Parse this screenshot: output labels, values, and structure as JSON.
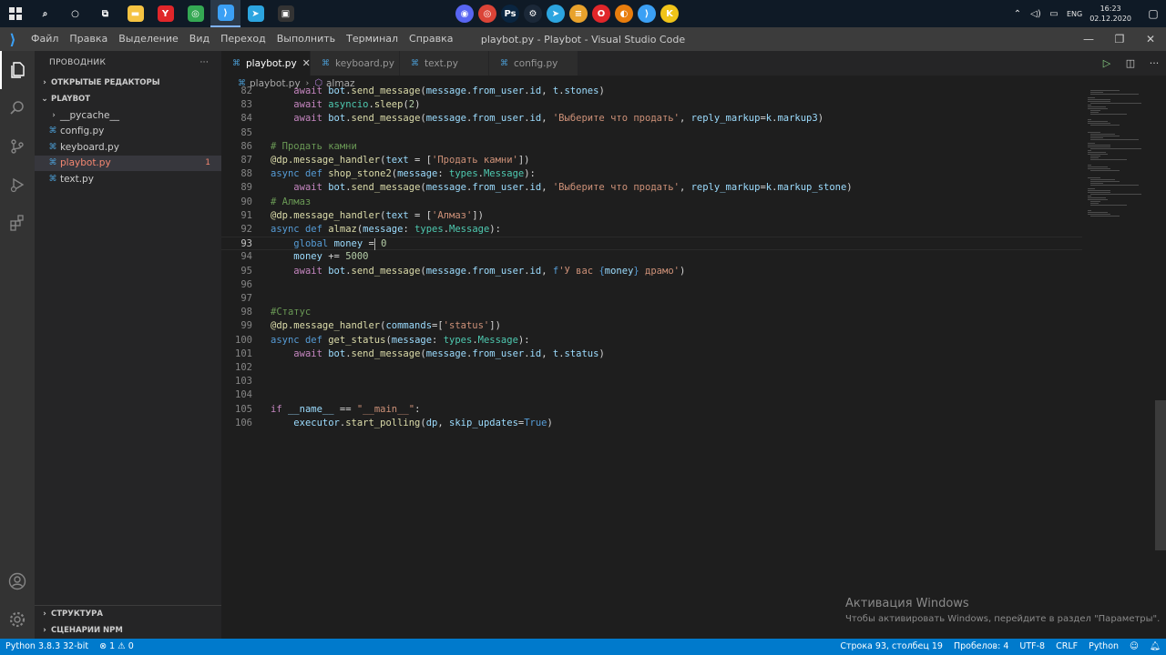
{
  "taskbar": {
    "start_icon": "windows-logo-icon",
    "pinned": [
      {
        "name": "search-icon",
        "glyph": "⌕"
      },
      {
        "name": "cortana-icon",
        "glyph": "○"
      },
      {
        "name": "task-view-icon",
        "glyph": "⧉"
      },
      {
        "name": "file-explorer-icon",
        "glyph": "▬",
        "color": "#f5c342"
      },
      {
        "name": "yandex-browser-icon",
        "glyph": "Y",
        "color": "#e0262a"
      },
      {
        "name": "chrome-icon",
        "glyph": "◎",
        "color": "#34a853"
      },
      {
        "name": "vscode-icon",
        "glyph": "⟩",
        "color": "#3ba0f5"
      },
      {
        "name": "telegram-icon",
        "glyph": "➤",
        "color": "#2ca5e0"
      },
      {
        "name": "terminal-icon",
        "glyph": "▣",
        "color": "#333333"
      }
    ],
    "center_apps": [
      {
        "name": "discord-icon",
        "color": "#5865f2",
        "glyph": "◉"
      },
      {
        "name": "chrome-app-icon",
        "color": "#db4437",
        "glyph": "◎"
      },
      {
        "name": "photoshop-icon",
        "color": "#0a2540",
        "glyph": "Ps"
      },
      {
        "name": "steam-icon",
        "color": "#1b2838",
        "glyph": "⚙"
      },
      {
        "name": "telegram-app-icon",
        "color": "#2ca5e0",
        "glyph": "➤"
      },
      {
        "name": "game-launcher-icon",
        "color": "#e8a22c",
        "glyph": "≡"
      },
      {
        "name": "opera-icon",
        "color": "#e0262a",
        "glyph": "O"
      },
      {
        "name": "blender-icon",
        "color": "#e87d0d",
        "glyph": "◐"
      },
      {
        "name": "vscode-app-icon",
        "color": "#3ba0f5",
        "glyph": "⟩"
      },
      {
        "name": "app-k-icon",
        "color": "#f0c419",
        "glyph": "K"
      }
    ],
    "tray": {
      "language": "ENG",
      "time": "16:23",
      "date": "02.12.2020"
    }
  },
  "window": {
    "title": "playbot.py - Playbot - Visual Studio Code",
    "menu": [
      "Файл",
      "Правка",
      "Выделение",
      "Вид",
      "Переход",
      "Выполнить",
      "Терминал",
      "Справка"
    ]
  },
  "explorer": {
    "header": "ПРОВОДНИК",
    "more": "···",
    "open_editors": "ОТКРЫТЫЕ РЕДАКТОРЫ",
    "project": "PLAYBOT",
    "items": [
      {
        "label": "__pycache__",
        "type": "folder"
      },
      {
        "label": "config.py",
        "type": "file"
      },
      {
        "label": "keyboard.py",
        "type": "file"
      },
      {
        "label": "playbot.py",
        "type": "file",
        "selected": true,
        "error": true,
        "badge": "1"
      },
      {
        "label": "text.py",
        "type": "file"
      }
    ],
    "outline": "СТРУКТУРА",
    "npm": "СЦЕНАРИИ NPM"
  },
  "tabs": [
    {
      "label": "playbot.py",
      "active": true,
      "close": "✕"
    },
    {
      "label": "keyboard.py",
      "active": false
    },
    {
      "label": "text.py",
      "active": false
    },
    {
      "label": "config.py",
      "active": false
    }
  ],
  "breadcrumb": {
    "file": "playbot.py",
    "symbol": "almaz"
  },
  "code_lines": [
    {
      "n": "82",
      "html": "    <span class='ctl'>await</span> <span class='var'>bot</span>.<span class='fn'>send_message</span>(<span class='var'>message</span>.<span class='var'>from_user</span>.<span class='var'>id</span>, <span class='var'>t</span>.<span class='var'>stones</span>)"
    },
    {
      "n": "83",
      "html": "    <span class='ctl'>await</span> <span class='type'>asyncio</span>.<span class='fn'>sleep</span>(<span class='num'>2</span>)"
    },
    {
      "n": "84",
      "html": "    <span class='ctl'>await</span> <span class='var'>bot</span>.<span class='fn'>send_message</span>(<span class='var'>message</span>.<span class='var'>from_user</span>.<span class='var'>id</span>, <span class='str'>'Выберите что продать'</span>, <span class='var'>reply_markup</span>=<span class='var'>k</span>.<span class='var'>markup3</span>)"
    },
    {
      "n": "85",
      "html": ""
    },
    {
      "n": "86",
      "html": "<span class='cmt'># Продать камни</span>"
    },
    {
      "n": "87",
      "html": "<span class='fn'>@dp.message_handler</span>(<span class='var'>text</span> = [<span class='str'>'Продать камни'</span>])"
    },
    {
      "n": "88",
      "html": "<span class='kw'>async</span> <span class='kw'>def</span> <span class='fn'>shop_stone2</span>(<span class='var'>message</span>: <span class='type'>types</span>.<span class='type'>Message</span>):"
    },
    {
      "n": "89",
      "html": "    <span class='ctl'>await</span> <span class='var'>bot</span>.<span class='fn'>send_message</span>(<span class='var'>message</span>.<span class='var'>from_user</span>.<span class='var'>id</span>, <span class='str'>'Выберите что продать'</span>, <span class='var'>reply_markup</span>=<span class='var'>k</span>.<span class='var'>markup_stone</span>)"
    },
    {
      "n": "90",
      "html": "<span class='cmt'># Алмаз</span>"
    },
    {
      "n": "91",
      "html": "<span class='fn'>@dp.message_handler</span>(<span class='var'>text</span> = [<span class='str'>'Алмаз'</span>])"
    },
    {
      "n": "92",
      "html": "<span class='kw'>async</span> <span class='kw'>def</span> <span class='fn'>almaz</span>(<span class='var'>message</span>: <span class='type'>types</span>.<span class='type'>Message</span>):"
    },
    {
      "n": "93",
      "html": "    <span class='kw'>global</span> <span class='var'>money</span> =<span class='cursor'></span> <span class='num'>0</span>",
      "current": true
    },
    {
      "n": "94",
      "html": "    <span class='var'>money</span> += <span class='num'>5000</span>"
    },
    {
      "n": "95",
      "html": "    <span class='ctl'>await</span> <span class='var'>bot</span>.<span class='fn'>send_message</span>(<span class='var'>message</span>.<span class='var'>from_user</span>.<span class='var'>id</span>, <span class='kw'>f</span><span class='str'>'У вас </span><span class='kw'>{</span><span class='var'>money</span><span class='kw'>}</span><span class='str'> драмо'</span>)"
    },
    {
      "n": "96",
      "html": ""
    },
    {
      "n": "97",
      "html": ""
    },
    {
      "n": "98",
      "html": "<span class='cmt'>#Статус</span>"
    },
    {
      "n": "99",
      "html": "<span class='fn'>@dp.message_handler</span>(<span class='var'>commands</span>=[<span class='str'>'status'</span>])"
    },
    {
      "n": "100",
      "html": "<span class='kw'>async</span> <span class='kw'>def</span> <span class='fn'>get_status</span>(<span class='var'>message</span>: <span class='type'>types</span>.<span class='type'>Message</span>):"
    },
    {
      "n": "101",
      "html": "    <span class='ctl'>await</span> <span class='var'>bot</span>.<span class='fn'>send_message</span>(<span class='var'>message</span>.<span class='var'>from_user</span>.<span class='var'>id</span>, <span class='var'>t</span>.<span class='var'>status</span>)"
    },
    {
      "n": "102",
      "html": ""
    },
    {
      "n": "103",
      "html": ""
    },
    {
      "n": "104",
      "html": ""
    },
    {
      "n": "105",
      "html": "<span class='ctl'>if</span> <span class='var'>__name__</span> == <span class='str'>\"__main__\"</span>:"
    },
    {
      "n": "106",
      "html": "    <span class='var'>executor</span>.<span class='fn'>start_polling</span>(<span class='var'>dp</span>, <span class='var'>skip_updates</span>=<span class='kw'>True</span>)"
    }
  ],
  "watermark": {
    "title": "Активация Windows",
    "subtitle": "Чтобы активировать Windows, перейдите в раздел \"Параметры\"."
  },
  "statusbar": {
    "interpreter": "Python 3.8.3 32-bit",
    "errors": "1",
    "warnings": "0",
    "position": "Строка 93, столбец 19",
    "spaces": "Пробелов: 4",
    "encoding": "UTF-8",
    "eol": "CRLF",
    "language": "Python"
  },
  "colors": {
    "accent": "#007acc",
    "error": "#f48771"
  }
}
